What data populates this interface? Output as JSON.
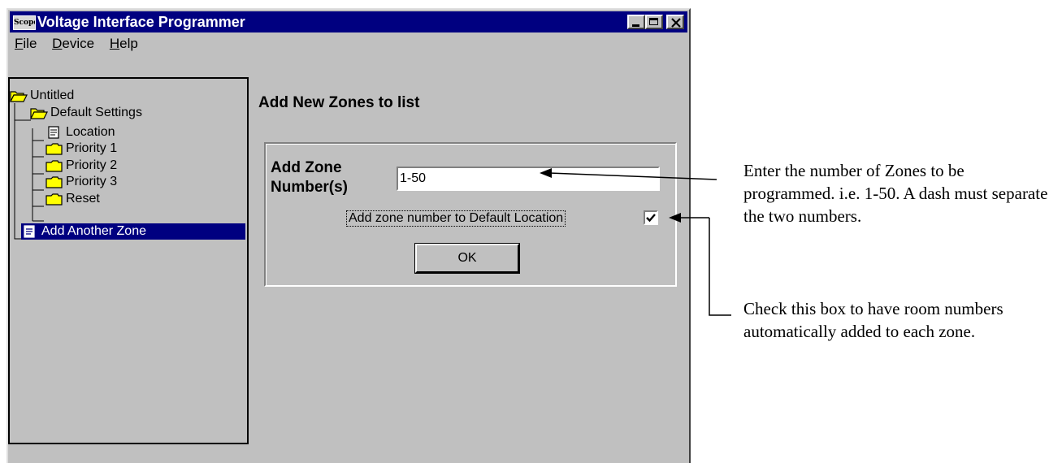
{
  "window": {
    "app_icon_text": "Scope",
    "title": "Voltage Interface Programmer"
  },
  "menu": [
    {
      "key": "F",
      "rest": "ile"
    },
    {
      "key": "D",
      "rest": "evice"
    },
    {
      "key": "H",
      "rest": "elp"
    }
  ],
  "tree": {
    "root": "Untitled",
    "default_settings": "Default Settings",
    "location": "Location",
    "priority1": "Priority 1",
    "priority2": "Priority 2",
    "priority3": "Priority 3",
    "reset": "Reset",
    "add_zone": "Add Another Zone"
  },
  "pane": {
    "title": "Add New Zones to list",
    "zone_label": "Add Zone Number(s)",
    "zone_value": "1-50",
    "checkbox_label": "Add zone number to Default Location",
    "checkbox_checked": true,
    "ok_label": "OK"
  },
  "annotations": {
    "zones_note": "Enter the number of  Zones to be programmed. i.e. 1-50.  A dash must separate the two numbers.",
    "checkbox_note": "Check this box to have room numbers automatically added to each zone."
  },
  "colors": {
    "title_bar": "#000080",
    "window_face": "#c0c0c0",
    "selection": "#000080",
    "folder": "#ffff00"
  },
  "icons": {
    "app": "scope-app-icon",
    "root": "open-folder-icon",
    "document": "document-icon",
    "folder": "folder-icon"
  }
}
